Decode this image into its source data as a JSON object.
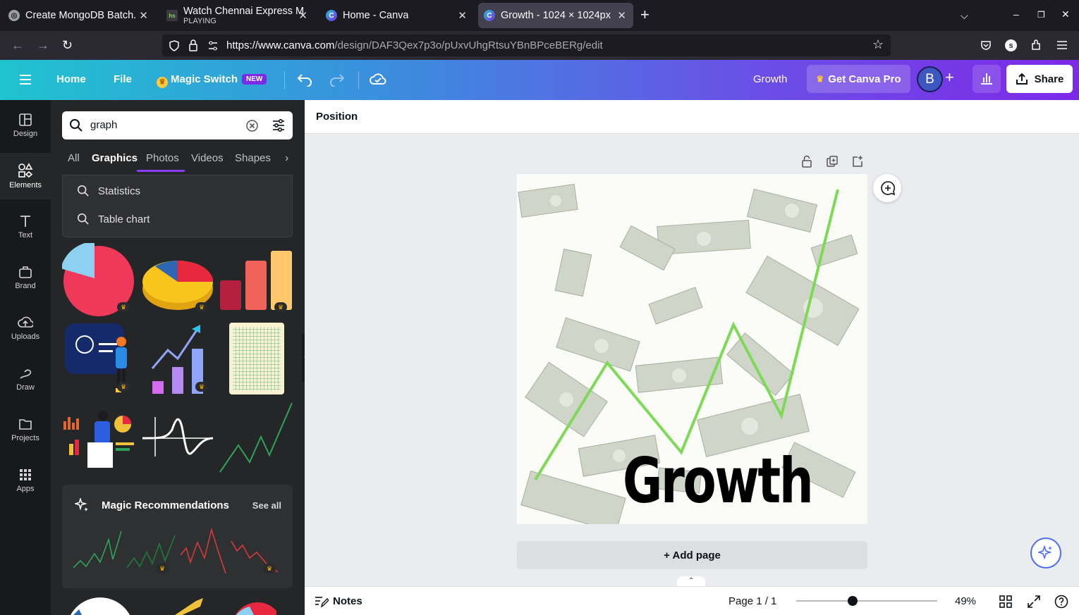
{
  "browser": {
    "tabs": [
      {
        "title": "Create MongoDB Batch.",
        "sub": ""
      },
      {
        "title": "Watch Chennai Express M",
        "sub": "PLAYING"
      },
      {
        "title": "Home - Canva",
        "sub": ""
      },
      {
        "title": "Growth - 1024 × 1024px",
        "sub": ""
      }
    ],
    "url_host": "https://www.canva.com",
    "url_path": "/design/DAF3Qex7p3o/pUxvUhgRtsuYBnBPceBERg/edit"
  },
  "header": {
    "home": "Home",
    "file": "File",
    "magic_switch": "Magic Switch",
    "new_badge": "NEW",
    "doc_title": "Growth",
    "get_pro": "Get Canva Pro",
    "avatar_letter": "B",
    "share": "Share"
  },
  "rail": [
    {
      "label": "Design",
      "icon": "design-icon"
    },
    {
      "label": "Elements",
      "icon": "elements-icon"
    },
    {
      "label": "Text",
      "icon": "text-icon"
    },
    {
      "label": "Brand",
      "icon": "brand-icon"
    },
    {
      "label": "Uploads",
      "icon": "uploads-icon"
    },
    {
      "label": "Draw",
      "icon": "draw-icon"
    },
    {
      "label": "Projects",
      "icon": "projects-icon"
    },
    {
      "label": "Apps",
      "icon": "apps-icon"
    }
  ],
  "panel": {
    "search_value": "graph",
    "tabs": [
      "All",
      "Graphics",
      "Photos",
      "Videos",
      "Shapes"
    ],
    "active_tab": "Graphics",
    "suggestions": [
      "Statistics",
      "Table chart"
    ],
    "magic_title": "Magic Recommendations",
    "see_all": "See all"
  },
  "editor": {
    "context_label": "Position",
    "canvas_text": "Growth",
    "add_page": "+ Add page"
  },
  "footer": {
    "notes": "Notes",
    "page_indicator": "Page 1 / 1",
    "zoom": "49%",
    "zoom_level": 0.49
  },
  "colors": {
    "accent": "#8b3dff",
    "growth_line": "#7ed957",
    "header_start": "#20c3d0",
    "header_end": "#7d2ae8"
  }
}
